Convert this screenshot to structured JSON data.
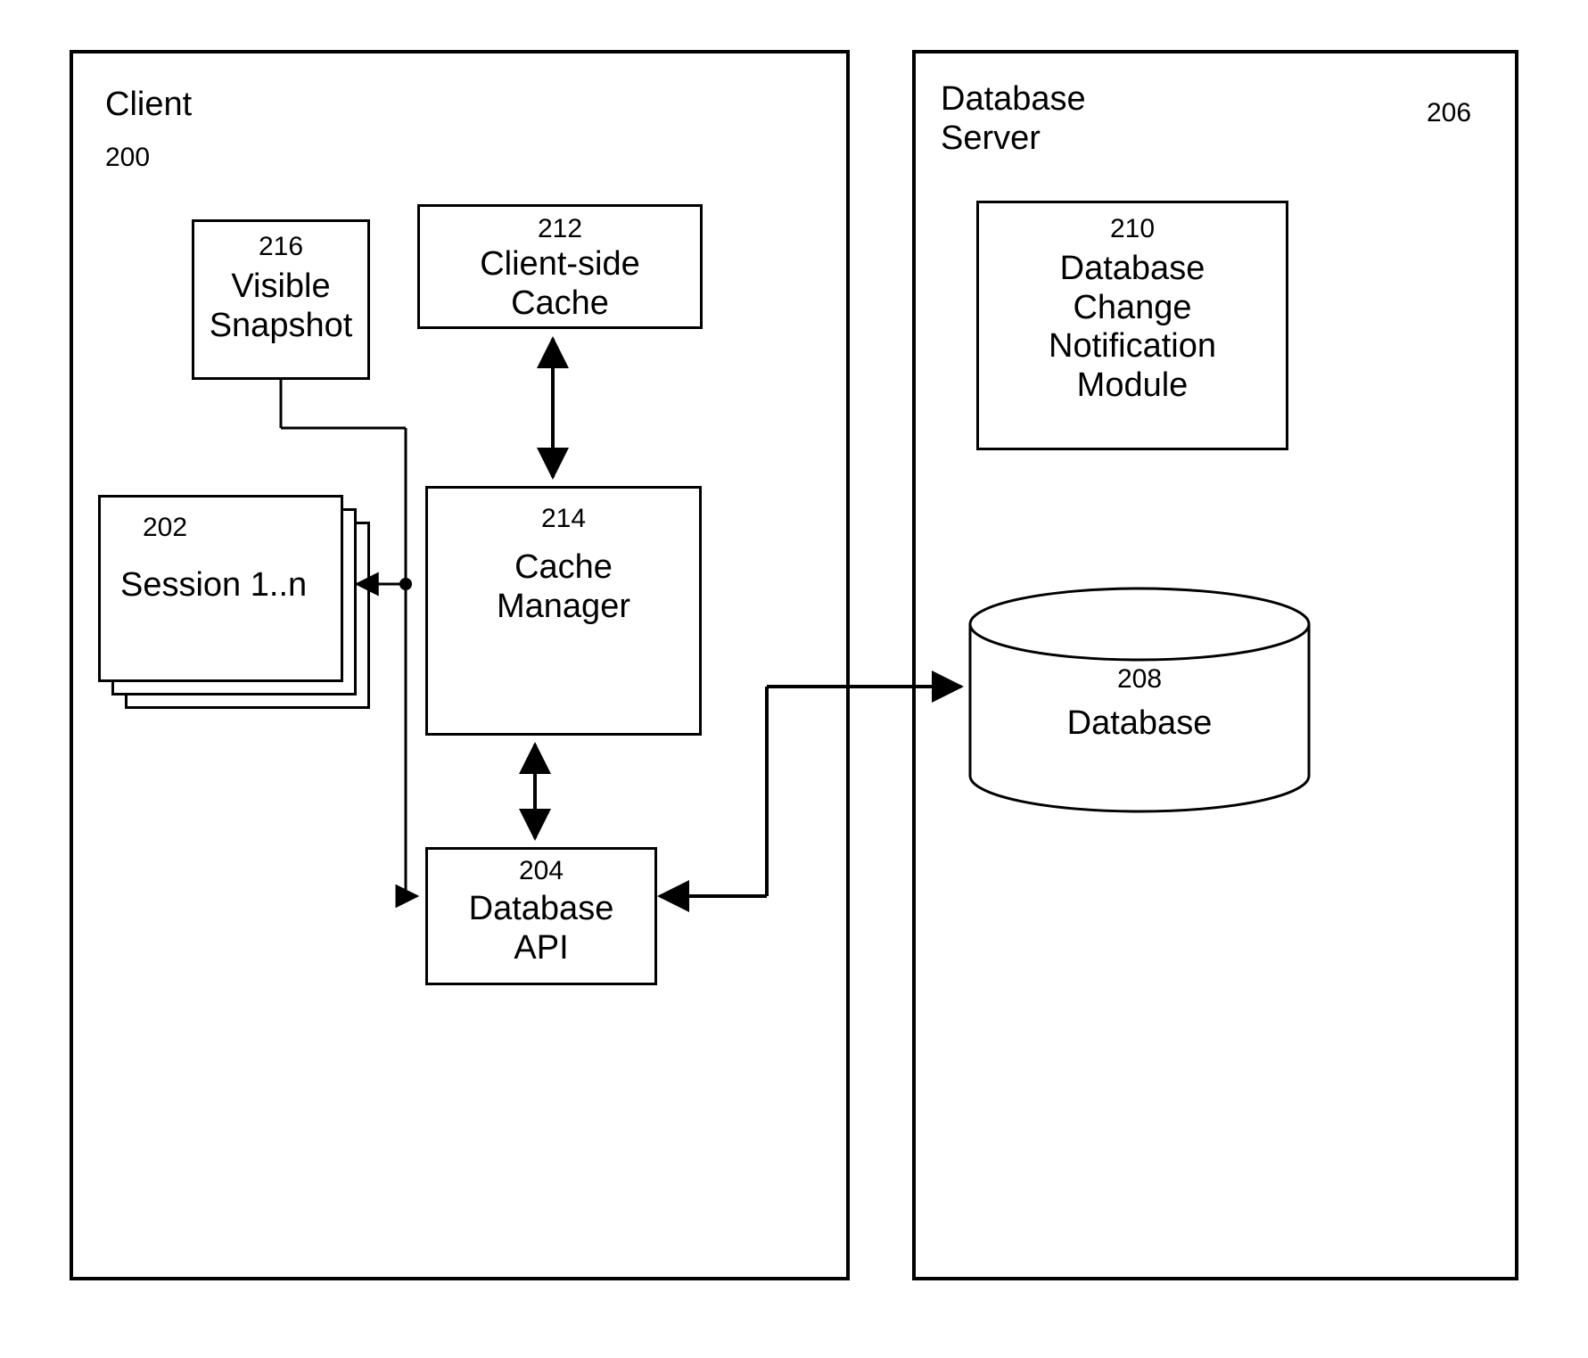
{
  "client": {
    "title": "Client",
    "id": "200",
    "visible_snapshot": {
      "id": "216",
      "label": "Visible\nSnapshot"
    },
    "client_cache": {
      "id": "212",
      "label": "Client-side\nCache"
    },
    "session": {
      "id": "202",
      "label": "Session 1..n"
    },
    "cache_manager": {
      "id": "214",
      "label": "Cache\nManager"
    },
    "db_api": {
      "id": "204",
      "label": "Database\nAPI"
    }
  },
  "server": {
    "title": "Database\nServer",
    "id": "206",
    "notif_module": {
      "id": "210",
      "label": "Database\nChange\nNotification\nModule"
    },
    "database": {
      "id": "208",
      "label": "Database"
    }
  }
}
